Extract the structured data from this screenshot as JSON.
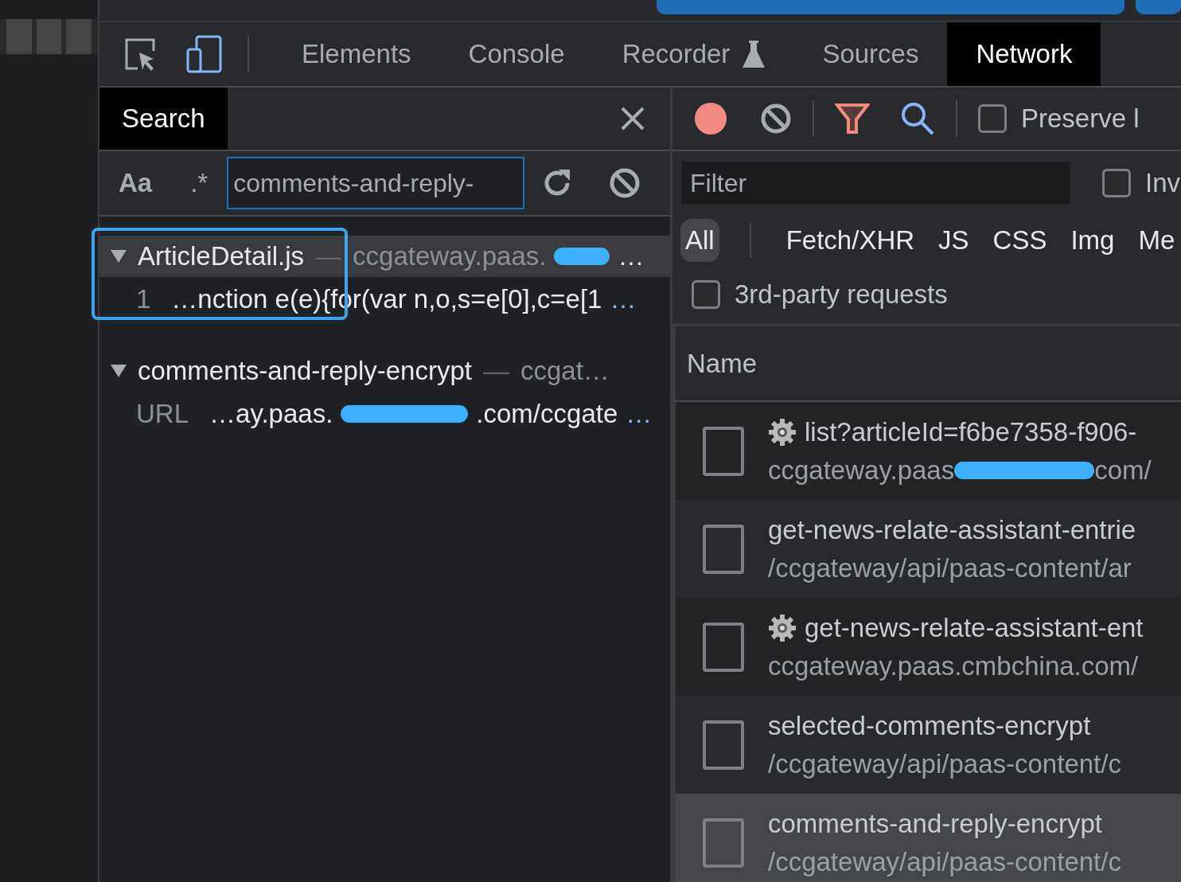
{
  "tabs": [
    {
      "label": "Elements",
      "selected": false,
      "kind": "text"
    },
    {
      "label": "Console",
      "selected": false,
      "kind": "text"
    },
    {
      "label": "Recorder",
      "selected": false,
      "kind": "flask"
    },
    {
      "label": "Sources",
      "selected": false,
      "kind": "text"
    },
    {
      "label": "Network",
      "selected": true,
      "kind": "text"
    }
  ],
  "search": {
    "tab": "Search",
    "case_toggle": "Aa",
    "regex_toggle": ".*",
    "value": "comments-and-reply-",
    "results": [
      {
        "file": "ArticleDetail.js",
        "dash": "—",
        "origin": "ccgateway.paas.",
        "origin_end": "…",
        "expanded": true,
        "highlighted": true,
        "matches": [
          {
            "label": "1",
            "text": "…nction e(e){for(var n,o,s=e[0],c=e[1",
            "rest": "…"
          }
        ]
      },
      {
        "file": "comments-and-reply-encrypt",
        "dash": "—",
        "origin": "ccgat…",
        "expanded": true,
        "highlighted": false,
        "matches": [
          {
            "label": "URL",
            "text": "…ay.paas.",
            "after": ".com/ccgate",
            "rest": "…"
          }
        ]
      }
    ]
  },
  "network": {
    "recording": true,
    "preserve_log": {
      "label": "Preserve l",
      "checked": false
    },
    "filter": {
      "placeholder": "Filter"
    },
    "invert": {
      "label": "Inv",
      "checked": false
    },
    "types": [
      {
        "label": "All",
        "selected": true
      },
      {
        "label": "Fetch/XHR",
        "selected": false
      },
      {
        "label": "JS",
        "selected": false
      },
      {
        "label": "CSS",
        "selected": false
      },
      {
        "label": "Img",
        "selected": false
      },
      {
        "label": "Me",
        "selected": false
      }
    ],
    "third_party": {
      "label": "3rd-party requests",
      "checked": false
    },
    "column": "Name",
    "rows": [
      {
        "name": "list?articleId=f6be7358-f906-",
        "path": "ccgateway.paas",
        "path_end": "com/",
        "redacted": true,
        "gear": true,
        "checked": false,
        "selected": false
      },
      {
        "name": "get-news-relate-assistant-entrie",
        "path": "/ccgateway/api/paas-content/ar",
        "redacted": false,
        "gear": false,
        "checked": false,
        "selected": false
      },
      {
        "name": "get-news-relate-assistant-ent",
        "path": "ccgateway.paas.cmbchina.com/",
        "redacted": false,
        "gear": true,
        "checked": false,
        "selected": false
      },
      {
        "name": "selected-comments-encrypt",
        "path": "/ccgateway/api/paas-content/c",
        "redacted": false,
        "gear": false,
        "checked": false,
        "selected": false
      },
      {
        "name": "comments-and-reply-encrypt",
        "path": "/ccgateway/api/paas-content/c",
        "redacted": false,
        "gear": false,
        "checked": false,
        "selected": true
      }
    ]
  }
}
